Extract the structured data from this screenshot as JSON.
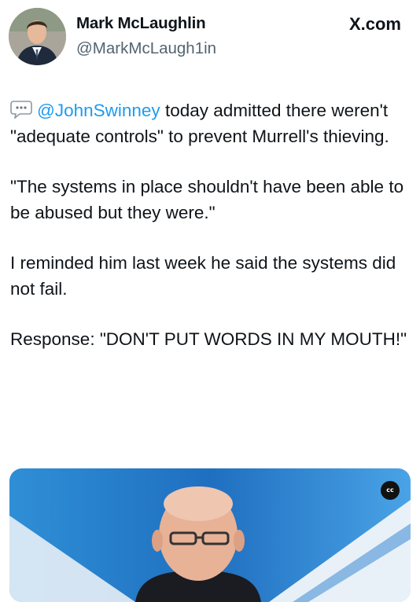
{
  "author": {
    "name": "Mark McLaughlin",
    "handle": "@MarkMcLaugh1in",
    "avatar_icon": "person-portrait"
  },
  "source_label": "X.com",
  "tweet": {
    "reply_icon": "speech-bubble-icon",
    "mention": "@JohnSwinney",
    "paragraph1_rest": " today admitted there weren't \"adequate controls\" to prevent Murrell's thieving.",
    "paragraph2": "\"The systems in place shouldn't have been able to be abused but they were.\"",
    "paragraph3": "I reminded him last week he said the systems did not fail.",
    "paragraph4": "Response: \"DON'T PUT WORDS IN MY MOUTH!\""
  },
  "media": {
    "caption_badge": "cc"
  },
  "colors": {
    "text": "#0f1419",
    "secondary": "#536471",
    "link": "#1d9bf0"
  }
}
